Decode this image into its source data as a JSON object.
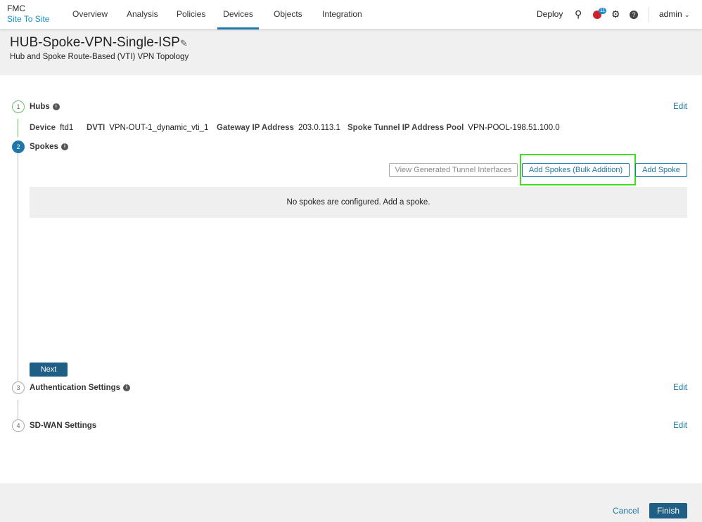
{
  "header": {
    "app": "FMC",
    "section": "Site To Site",
    "nav": [
      "Overview",
      "Analysis",
      "Policies",
      "Devices",
      "Objects",
      "Integration"
    ],
    "active": "Devices",
    "deploy": "Deploy",
    "notification_count": "11",
    "user": "admin"
  },
  "page": {
    "title": "HUB-Spoke-VPN-Single-ISP",
    "subtitle": "Hub and Spoke Route-Based (VTI) VPN Topology"
  },
  "steps": [
    {
      "num": "1",
      "label": "Hubs",
      "edit": "Edit"
    },
    {
      "num": "2",
      "label": "Spokes"
    },
    {
      "num": "3",
      "label": "Authentication Settings",
      "edit": "Edit"
    },
    {
      "num": "4",
      "label": "SD-WAN Settings",
      "edit": "Edit"
    }
  ],
  "hub": {
    "device_label": "Device",
    "device": "ftd1",
    "dvti_label": "DVTI",
    "dvti": "VPN-OUT-1_dynamic_vti_1",
    "gw_label": "Gateway IP Address",
    "gw": "203.0.113.1",
    "pool_label": "Spoke Tunnel IP Address Pool",
    "pool": "VPN-POOL-198.51.100.0"
  },
  "spokes": {
    "view_tunnels": "View Generated Tunnel Interfaces",
    "bulk_add": "Add Spokes (Bulk Addition)",
    "add": "Add Spoke",
    "empty": "No spokes are configured. Add a spoke.",
    "next": "Next"
  },
  "footer": {
    "cancel": "Cancel",
    "finish": "Finish"
  }
}
